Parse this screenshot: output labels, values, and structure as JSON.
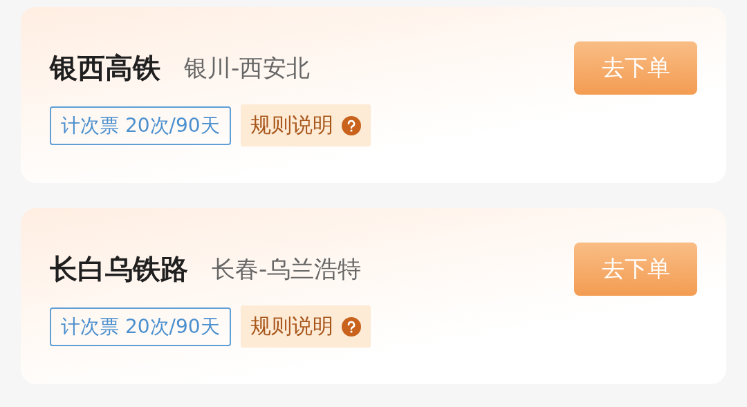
{
  "cards": [
    {
      "title": "银西高铁",
      "route": "银川-西安北",
      "ticket_tag": "计次票 20次/90天",
      "rules_link": "规则说明",
      "order_button": "去下单"
    },
    {
      "title": "长白乌铁路",
      "route": "长春-乌兰浩特",
      "ticket_tag": "计次票 20次/90天",
      "rules_link": "规则说明",
      "order_button": "去下单"
    }
  ]
}
